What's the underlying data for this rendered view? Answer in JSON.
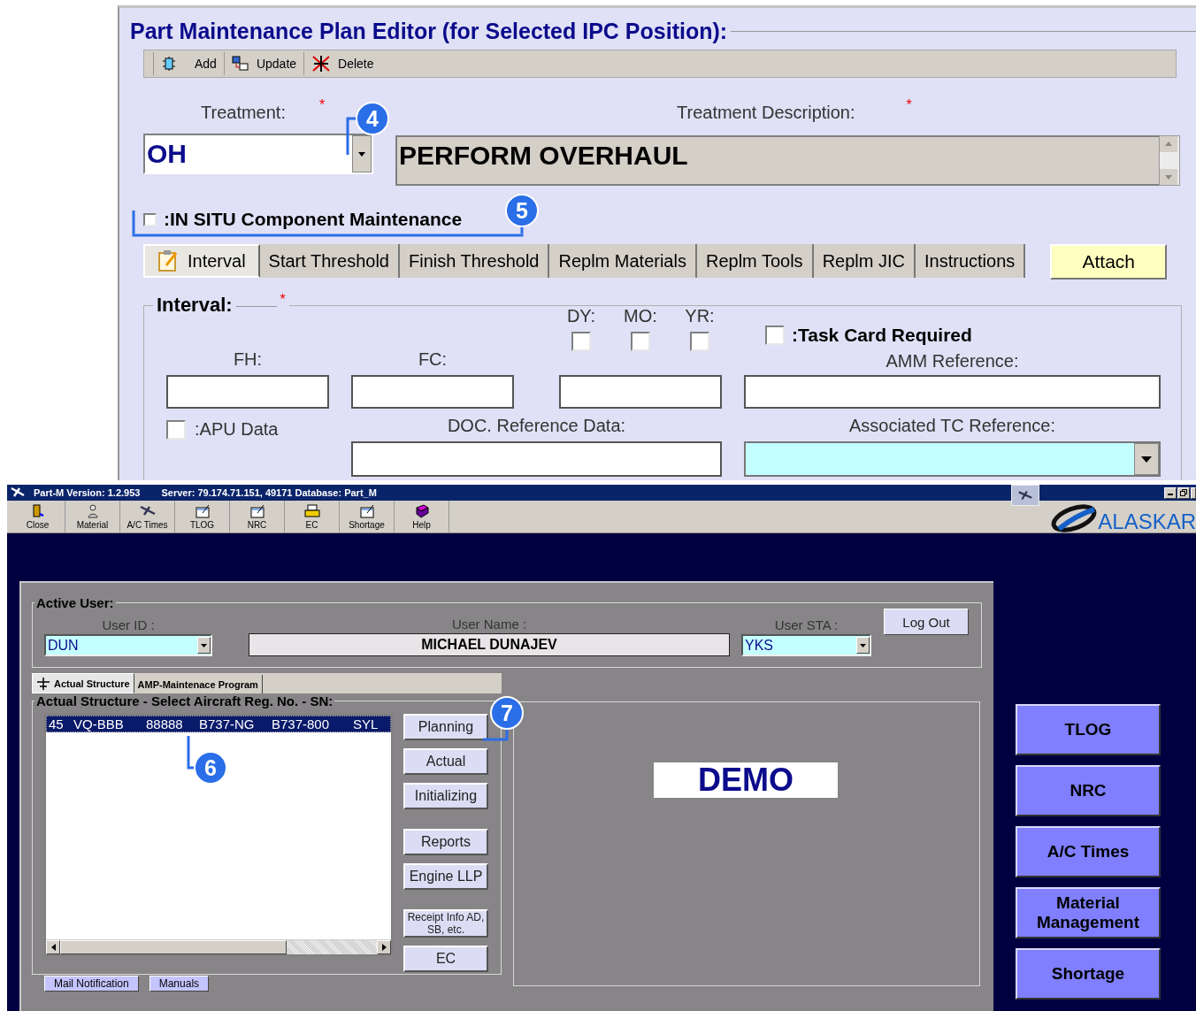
{
  "editor": {
    "title": "Part Maintenance Plan Editor (for Selected IPC Position):",
    "toolbar": [
      {
        "label": "Add",
        "kind": "chip"
      },
      {
        "label": "Update",
        "kind": "update"
      },
      {
        "label": "Delete",
        "kind": "delete"
      }
    ],
    "treatment": {
      "label": "Treatment:",
      "required_mark": "*",
      "value": "OH"
    },
    "description": {
      "label": "Treatment Description:",
      "required_mark": "*",
      "value": "PERFORM OVERHAUL"
    },
    "in_situ": {
      "label": ":IN SITU Component Maintenance",
      "checked": false
    },
    "tabs": [
      {
        "label": "Interval",
        "selected": true
      },
      {
        "label": "Start Threshold",
        "selected": false
      },
      {
        "label": "Finish Threshold",
        "selected": false
      },
      {
        "label": "Replm Materials",
        "selected": false
      },
      {
        "label": "Replm Tools",
        "selected": false
      },
      {
        "label": "Replm JIC",
        "selected": false
      },
      {
        "label": "Instructions",
        "selected": false
      }
    ],
    "attach_button": "Attach",
    "interval": {
      "legend": "Interval:",
      "required_mark": "*",
      "period_checks": [
        {
          "label": "DY:",
          "checked": false
        },
        {
          "label": "MO:",
          "checked": false
        },
        {
          "label": "YR:",
          "checked": false
        }
      ],
      "task_card": {
        "label": ":Task Card Required",
        "checked": false
      },
      "fh_label": "FH:",
      "fc_label": "FC:",
      "amm_label": "AMM Reference:",
      "apu": {
        "label": ":APU Data",
        "checked": false
      },
      "doc_label": "DOC. Reference Data:",
      "tc_label": "Associated TC Reference:"
    }
  },
  "app": {
    "title": "Part-M  Version: 1.2.953",
    "server": "Server: 79.174.71.151, 49171 Database: Part_M",
    "toolbar": [
      {
        "label": "Close",
        "kind": "door"
      },
      {
        "label": "Material",
        "kind": "person"
      },
      {
        "label": "A/C Times",
        "kind": "plane"
      },
      {
        "label": "TLOG",
        "kind": "note"
      },
      {
        "label": "NRC",
        "kind": "note"
      },
      {
        "label": "EC",
        "kind": "printer"
      },
      {
        "label": "Shortage",
        "kind": "note"
      },
      {
        "label": "Help",
        "kind": "book"
      }
    ],
    "logo": "ALASKAR",
    "active_user": {
      "legend": "Active User:",
      "user_id_label": "User ID :",
      "user_id": "DUN",
      "user_name_label": "User Name :",
      "user_name": "MICHAEL DUNAJEV",
      "user_sta_label": "User STA :",
      "user_sta": "YKS",
      "logout_button": "Log Out"
    },
    "tabs": [
      {
        "label": "Actual Structure",
        "selected": true
      },
      {
        "label": "AMP-Maintenace Program",
        "selected": false
      }
    ],
    "structure": {
      "legend": "Actual Structure - Select Aircraft Reg. No. - SN:",
      "rows": [
        {
          "cells": [
            "45",
            "VQ-BBB",
            "88888",
            "B737-NG",
            "B737-800",
            "SYL"
          ],
          "selected": true
        }
      ],
      "button_groups": [
        [
          "Planning",
          "Actual",
          "Initializing"
        ],
        [
          "Reports",
          "Engine LLP"
        ],
        [
          "Receipt Info AD, SB, etc.",
          "EC"
        ]
      ],
      "footer_buttons": [
        "Mail Notification",
        "Manuals"
      ]
    },
    "demo": "DEMO",
    "side_buttons": [
      "TLOG",
      "NRC",
      "A/C Times",
      "Material Management",
      "Shortage"
    ]
  },
  "callouts": [
    {
      "number": "4"
    },
    {
      "number": "5"
    },
    {
      "number": "6"
    },
    {
      "number": "7"
    }
  ]
}
